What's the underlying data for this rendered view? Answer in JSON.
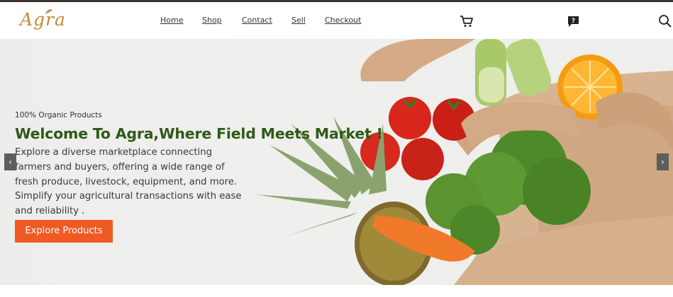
{
  "brand": {
    "logo_text": "Agra"
  },
  "nav": {
    "links": [
      "Home",
      "Shop",
      "Contact",
      "Sell",
      "Checkout"
    ]
  },
  "icons": {
    "cart": "cart-icon",
    "help": "help-icon",
    "search": "search-icon"
  },
  "hero": {
    "subtitle": "100% Organic Products",
    "title": "Welcome To Agra,Where Field Meets Market !",
    "description": "Explore a diverse marketplace connecting farmers and buyers, offering a wide range of fresh produce, livestock, equipment, and more. Simplify your agricultural transactions with ease and reliability .",
    "cta_label": "Explore Products",
    "prev_label": "‹",
    "next_label": "›"
  },
  "colors": {
    "accent": "#ef5a23",
    "title_green": "#2f5a17",
    "logo_gold": "#c9893a"
  }
}
